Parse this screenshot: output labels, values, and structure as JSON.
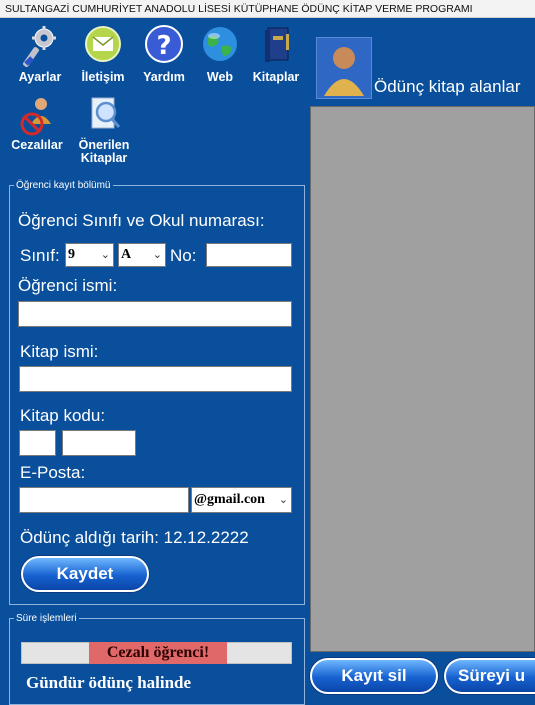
{
  "window": {
    "title": "SULTANGAZİ CUMHURİYET ANADOLU LİSESİ KÜTÜPHANE ÖDÜNÇ KİTAP VERME PROGRAMI"
  },
  "toolbar": {
    "items": [
      {
        "label": "Ayarlar",
        "icon": "wrench-gear-icon"
      },
      {
        "label": "İletişim",
        "icon": "envelope-icon"
      },
      {
        "label": "Yardım",
        "icon": "question-icon"
      },
      {
        "label": "Web",
        "icon": "globe-icon"
      },
      {
        "label": "Kitaplar",
        "icon": "book-icon"
      },
      {
        "label": "Cezalılar",
        "icon": "banned-user-icon"
      },
      {
        "label": "Önerilen Kitaplar",
        "icon": "search-document-icon"
      }
    ]
  },
  "right": {
    "header": "Ödünç kitap alanlar"
  },
  "form": {
    "legend": "Öğrenci kayıt bölümü",
    "heading": "Öğrenci Sınıfı ve Okul numarası:",
    "class_label": "Sınıf:",
    "class_value": "9",
    "section_value": "A",
    "no_label": "No:",
    "no_value": "",
    "student_name_label": "Öğrenci ismi:",
    "student_name_value": "",
    "book_name_label": "Kitap ismi:",
    "book_name_value": "",
    "book_code_label": "Kitap kodu:",
    "book_code_part1": "",
    "book_code_part2": "",
    "email_label": "E-Posta:",
    "email_value": "",
    "email_domain": "@gmail.con",
    "date_label": "Ödünç aldığı tarih: 12.12.2222",
    "save_button": "Kaydet"
  },
  "duration": {
    "legend": "Süre işlemleri",
    "status_badge": "Cezalı öğrenci!",
    "days_text": "Gündür ödünç halinde"
  },
  "actions": {
    "delete_button": "Kayıt sil",
    "extend_button": "Süreyi u"
  },
  "colors": {
    "background": "#0a4f9c",
    "penalty_badge": "#e06868",
    "panel_gray": "#a0a0a0"
  }
}
